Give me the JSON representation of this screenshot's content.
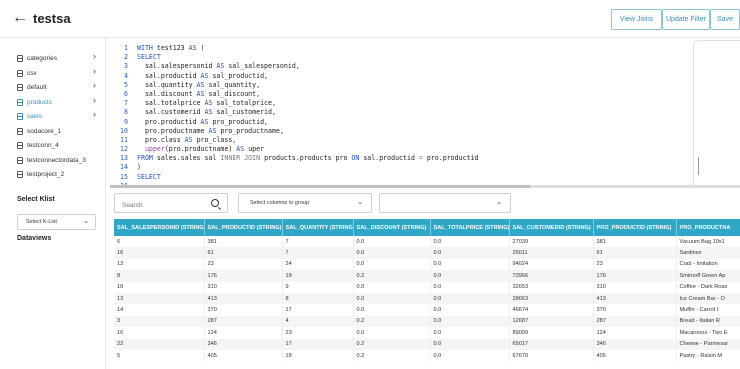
{
  "header": {
    "back_icon": "arrow-left-icon",
    "title": "testsa",
    "view_joins": "View Joins",
    "update_filter": "Update Filter",
    "save": "Save"
  },
  "sidebar": {
    "items": [
      {
        "label": "categories",
        "active": false
      },
      {
        "label": "csv",
        "active": false
      },
      {
        "label": "default",
        "active": false
      },
      {
        "label": "products",
        "active": true
      },
      {
        "label": "sales",
        "active": true
      },
      {
        "label": "sodacore_1",
        "active": false
      },
      {
        "label": "testconn_4",
        "active": false
      },
      {
        "label": "testconnectordata_3",
        "active": false
      },
      {
        "label": "testproject_2",
        "active": false
      }
    ],
    "select_klist_label": "Select Klist",
    "klist_value": "Select K-List",
    "dataviews_label": "Dataviews"
  },
  "editor": {
    "line_numbers": [
      "1",
      "2",
      "3",
      "4",
      "5",
      "6",
      "7",
      "8",
      "9",
      "10",
      "11",
      "12",
      "13",
      "14",
      "15",
      "16"
    ]
  },
  "controls": {
    "search_placeholder": "Search",
    "group_columns": "Select columns to group",
    "second_dropdown": ""
  },
  "table": {
    "columns": [
      "SAL_SALESPERSONID (STRING)",
      "SAL_PRODUCTID (STRING)",
      "SAL_QUANTITY (STRING)",
      "SAL_DISCOUNT (STRING)",
      "SAL_TOTALPRICE (STRING)",
      "SAL_CUSTOMERID (STRING)",
      "PRO_PRODUCTID (STRING)",
      "PRO_PRODUCTNA"
    ],
    "rows": [
      [
        "6",
        "381",
        "7",
        "0.0",
        "0.0",
        "27039",
        "381",
        "Vacuum Bag 10x1"
      ],
      [
        "16",
        "61",
        "7",
        "0.0",
        "0.0",
        "25011",
        "61",
        "Sardines"
      ],
      [
        "13",
        "23",
        "24",
        "0.0",
        "0.0",
        "94024",
        "23",
        "Crab - Imitation"
      ],
      [
        "8",
        "176",
        "19",
        "0.2",
        "0.0",
        "73966",
        "176",
        "Smirnoff Green Ap"
      ],
      [
        "10",
        "310",
        "9",
        "0.0",
        "0.0",
        "32653",
        "310",
        "Coffee - Dark Roas"
      ],
      [
        "13",
        "413",
        "8",
        "0.0",
        "0.0",
        "28663",
        "413",
        "Ice Cream Bar - O"
      ],
      [
        "14",
        "370",
        "17",
        "0.0",
        "0.0",
        "46674",
        "370",
        "Muffin - Carrot I"
      ],
      [
        "3",
        "287",
        "4",
        "0.2",
        "0.0",
        "12687",
        "287",
        "Bread - Italian R"
      ],
      [
        "16",
        "124",
        "23",
        "0.0",
        "0.0",
        "89009",
        "124",
        "Macaroons - Two E"
      ],
      [
        "22",
        "346",
        "17",
        "0.2",
        "0.0",
        "65017",
        "346",
        "Cheese - Parmesar"
      ],
      [
        "5",
        "405",
        "18",
        "0.2",
        "0.0",
        "67670",
        "405",
        "Pastry - Raisin M"
      ]
    ]
  },
  "colors": {
    "accent": "#3a8fb4",
    "table_header": "#2fa7c6"
  }
}
